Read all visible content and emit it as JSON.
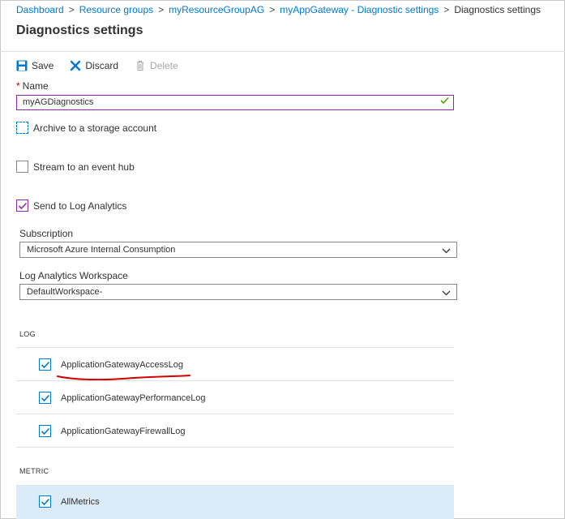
{
  "breadcrumb": {
    "items": [
      "Dashboard",
      "Resource groups",
      "myResourceGroupAG",
      "myAppGateway - Diagnostic settings"
    ],
    "current": "Diagnostics settings",
    "separator": ">"
  },
  "page": {
    "title": "Diagnostics settings"
  },
  "toolbar": {
    "save_label": "Save",
    "discard_label": "Discard",
    "delete_label": "Delete"
  },
  "form": {
    "name_required_mark": "*",
    "name_label": "Name",
    "name_value": "myAGDiagnostics",
    "archive_label": "Archive to a storage account",
    "archive_checked": false,
    "stream_label": "Stream to an event hub",
    "stream_checked": false,
    "loganalytics_label": "Send to Log Analytics",
    "loganalytics_checked": true,
    "subscription_label": "Subscription",
    "subscription_value": "Microsoft Azure Internal Consumption",
    "workspace_label": "Log Analytics Workspace",
    "workspace_value": "DefaultWorkspace-"
  },
  "log": {
    "section_label": "LOG",
    "items": [
      {
        "label": "ApplicationGatewayAccessLog",
        "checked": true
      },
      {
        "label": "ApplicationGatewayPerformanceLog",
        "checked": true
      },
      {
        "label": "ApplicationGatewayFirewallLog",
        "checked": true
      }
    ]
  },
  "metric": {
    "section_label": "METRIC",
    "items": [
      {
        "label": "AllMetrics",
        "checked": true
      }
    ]
  },
  "colors": {
    "accent": "#0078d4",
    "focus_border": "#8a2aa8",
    "valid_check": "#57a300",
    "annotation": "#d40000",
    "selected_row": "#dcebf8"
  }
}
